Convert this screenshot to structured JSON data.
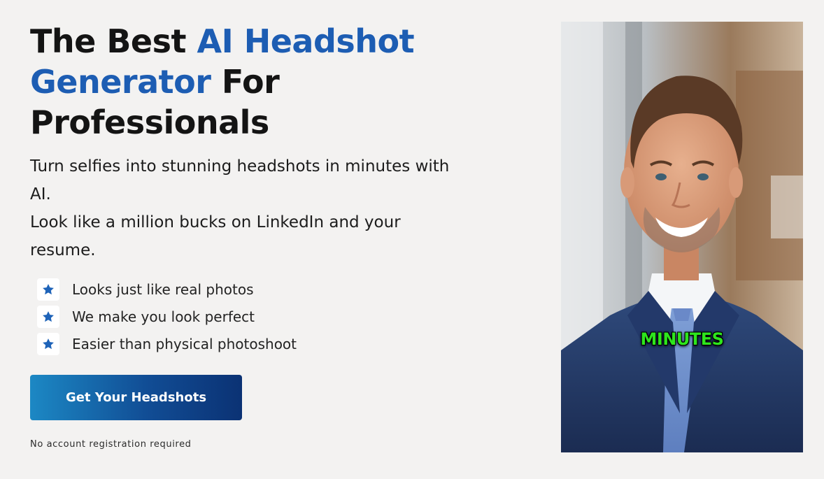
{
  "hero": {
    "headline_part1": "The Best ",
    "headline_accent": "AI Headshot Generator",
    "headline_part2": " For Professionals",
    "subhead_line1": "Turn selfies into stunning headshots in minutes with AI.",
    "subhead_line2": "Look like a million bucks on LinkedIn and your resume.",
    "accent_color": "#1d5db3"
  },
  "features": [
    {
      "icon": "star-icon",
      "label": "Looks just like real photos"
    },
    {
      "icon": "star-icon",
      "label": "We make you look perfect"
    },
    {
      "icon": "star-icon",
      "label": "Easier than physical photoshoot"
    }
  ],
  "cta": {
    "label": "Get Your Headshots",
    "footnote": "No account registration required"
  },
  "photo": {
    "overlay_text": "MINUTES",
    "overlay_color": "#2ee61d"
  }
}
